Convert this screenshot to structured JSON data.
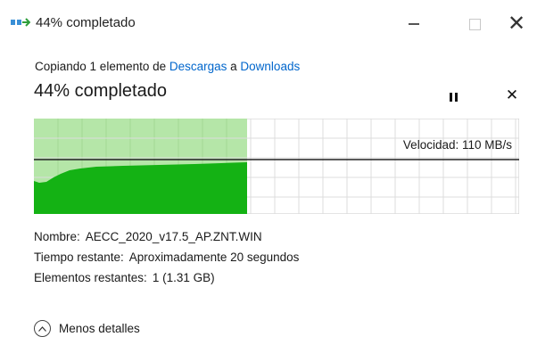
{
  "window": {
    "title": "44% completado"
  },
  "dialog": {
    "copy_prefix": "Copiando 1 elemento de ",
    "source": "Descargas",
    "connector": " a ",
    "destination": "Downloads",
    "percent_text": "44% completado",
    "progress": 0.44,
    "speed_label": "Velocidad: 110 MB/s"
  },
  "details": {
    "name_label": "Nombre:",
    "name_value": "AECC_2020_v17.5_AP.ZNT.WIN",
    "time_label": "Tiempo restante:",
    "time_value": "Aproximadamente 20 segundos",
    "items_label": "Elementos restantes:",
    "items_value": "1 (1.31 GB)"
  },
  "toggle": {
    "label": "Menos detalles"
  },
  "colors": {
    "progress_fill": "#b5e6a8",
    "speed_fill": "#14b214",
    "grid": "#dcdcdc",
    "link": "#0066cc",
    "speed_line": "#222222"
  },
  "icons": {
    "title": "copy-transfer-icon",
    "minimize": "minimize-icon",
    "maximize": "maximize-icon",
    "close": "close-icon",
    "pause": "pause-icon",
    "cancel": "cancel-icon",
    "toggle": "chevron-up-icon"
  }
}
